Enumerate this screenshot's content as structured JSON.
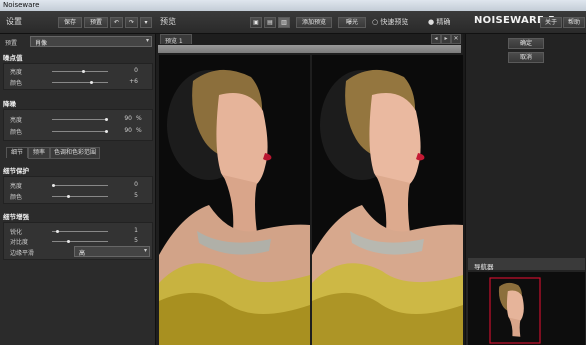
{
  "window": {
    "title": "Noiseware"
  },
  "toolbar": {
    "settings_label": "设置",
    "save_label": "保存",
    "preset_label": "预置",
    "preview_label": "预览",
    "add_preset_label": "添加预览",
    "sharpen_label": "曝光",
    "fast_preview_label": "快速预览",
    "accurate_label": "精确",
    "brand": "NOISEWARE 5",
    "about_label": "关于",
    "help_label": "帮助"
  },
  "left": {
    "preset_field_label": "预置",
    "preset_value": "肖像",
    "noise_level": {
      "title": "噪点值",
      "rows": [
        {
          "label": "亮度",
          "value": "0"
        },
        {
          "label": "颜色",
          "value": "+6"
        }
      ]
    },
    "noise_reduction": {
      "title": "降噪",
      "rows": [
        {
          "label": "亮度",
          "value": "90",
          "unit": "%"
        },
        {
          "label": "颜色",
          "value": "90",
          "unit": "%"
        }
      ]
    },
    "tabs": [
      "细节",
      "频率",
      "色调和色彩范围"
    ],
    "detail_protection": {
      "title": "细节保护",
      "rows": [
        {
          "label": "亮度",
          "value": "0"
        },
        {
          "label": "颜色",
          "value": "5"
        }
      ]
    },
    "detail_enhance": {
      "title": "细节增强",
      "rows": [
        {
          "label": "锐化",
          "value": "1"
        },
        {
          "label": "对比度",
          "value": "5"
        }
      ],
      "edge_label": "边缘平滑",
      "edge_value": "高"
    }
  },
  "preview": {
    "tab_label": "预览 1"
  },
  "right": {
    "ok_label": "确定",
    "cancel_label": "取消",
    "navigator_label": "导航器"
  },
  "colors": {
    "accent": "#c8102e",
    "panel": "#2b2b2b"
  }
}
